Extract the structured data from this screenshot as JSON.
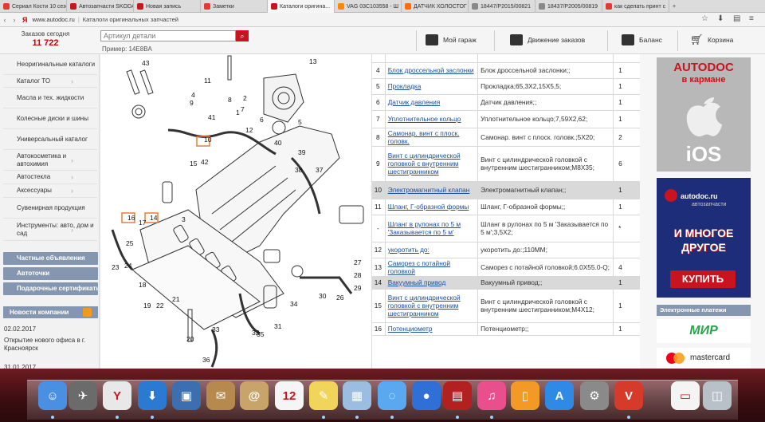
{
  "browser": {
    "tabs": [
      {
        "label": "Сериал Кости 10 сезо",
        "color": "#e53935"
      },
      {
        "label": "Автозапчасти SKODA",
        "color": "#c8141e"
      },
      {
        "label": "Новая запись",
        "color": "#c8141e"
      },
      {
        "label": "Заметки",
        "color": "#e53935"
      },
      {
        "label": "Каталоги оригина...",
        "color": "#c8141e"
      },
      {
        "label": "VAG 03C103558 - Ш",
        "color": "#ff8800"
      },
      {
        "label": "ДАТЧИК ХОЛОСТОГ",
        "color": "#ff6d00"
      },
      {
        "label": "18447/P2015/00821",
        "color": "#888888"
      },
      {
        "label": "18437/P2005/00819",
        "color": "#888888"
      },
      {
        "label": "как сделать принт с",
        "color": "#e53935"
      }
    ],
    "url": "www.autodoc.ru",
    "page_title": "Каталоги оригинальных запчастей"
  },
  "header": {
    "orders_label": "Заказов сегодня",
    "orders_count": "11 722",
    "search_placeholder": "Артикул детали",
    "example": "Пример: 14E8BA",
    "nav": [
      "Мой гараж",
      "Движение заказов",
      "Баланс",
      "Корзина"
    ]
  },
  "sidebar": {
    "items": [
      "Неоригинальные каталоги",
      "Каталог ТО",
      "Масла и тех. жидкости",
      "Колесные диски и шины",
      "Универсальный каталог",
      "Автокосметика и автохимия",
      "Автостекла",
      "Аксессуары",
      "Сувенирная продукция",
      "Инструменты: авто, дом и сад"
    ],
    "buttons": [
      "Частные объявления",
      "Автоточки",
      "Подарочные сертификаты"
    ],
    "news_title": "Новости компании",
    "news": [
      {
        "date": "02.02.2017",
        "text": "Открытие нового офиса в г. Красноярск"
      },
      {
        "date": "31.01.2017",
        "text": ""
      }
    ]
  },
  "diagram": {
    "labels": [
      "43",
      "13",
      "11",
      "2",
      "9",
      "8",
      "7",
      "6",
      "41",
      "1",
      "10",
      "5",
      "40",
      "39",
      "38",
      "42",
      "37",
      "15",
      "3",
      "16",
      "14",
      "17",
      "24",
      "25",
      "23",
      "21",
      "22",
      "19",
      "20",
      "33",
      "35",
      "32",
      "31",
      "34",
      "30",
      "26",
      "27",
      "28",
      "29",
      "36",
      "18",
      "4",
      "12"
    ]
  },
  "parts_table": {
    "rows": [
      {
        "n": "4",
        "name": "Блок дроссельной заслонки",
        "desc": "Блок дроссельной заслонки;;",
        "qty": "1",
        "hl": false
      },
      {
        "n": "5",
        "name": "Прокладка",
        "desc": "Прокладка;65,3X2,15X5,5;",
        "qty": "1",
        "hl": false
      },
      {
        "n": "6",
        "name": "Датчик давления",
        "desc": "Датчик давления;;",
        "qty": "1",
        "hl": false
      },
      {
        "n": "7",
        "name": "Уплотнительное кольцо",
        "desc": "Уплотнительное кольцо;7,59X2,62;",
        "qty": "1",
        "hl": false
      },
      {
        "n": "8",
        "name": "Самонар. винт с плоск. головк.",
        "desc": "Самонар. винт с плоск. головк.;5X20;",
        "qty": "2",
        "hl": false
      },
      {
        "n": "9",
        "name": "Винт с цилиндрической головкой с внутренним шестигранником",
        "desc": "Винт с цилиндрической головкой с внутренним шестигранником;M8X35;",
        "qty": "6",
        "hl": false
      },
      {
        "n": "10",
        "name": "Электромагнитный клапан",
        "desc": "Электромагнитный клапан;;",
        "qty": "1",
        "hl": true
      },
      {
        "n": "11",
        "name": "Шланг, Г-образной формы",
        "desc": "Шланг, Г-образной формы;;",
        "qty": "1",
        "hl": false
      },
      {
        "n": "-",
        "name": "Шланг в рулонах по 5 м 'Заказывается по 5 м'",
        "desc": "Шланг в рулонах по 5 м 'Заказывается по 5 м';3,5X2;",
        "qty": "*",
        "hl": false
      },
      {
        "n": "12",
        "name": "укоротить до:",
        "desc": "укоротить до:;110MM;",
        "qty": "",
        "hl": false
      },
      {
        "n": "13",
        "name": "Саморез с потайной головкой",
        "desc": "Саморез с потайной головкой;6.0X55.0-Q;",
        "qty": "4",
        "hl": false
      },
      {
        "n": "14",
        "name": "Вакуумный привод",
        "desc": "Вакуумный привод;;",
        "qty": "1",
        "hl": true
      },
      {
        "n": "15",
        "name": "Винт с цилиндрической головкой с внутренним шестигранником",
        "desc": "Винт с цилиндрической головкой с внутренним шестигранником;M4X12;",
        "qty": "1",
        "hl": false
      },
      {
        "n": "16",
        "name": "Потенциометр",
        "desc": "Потенциометр;;",
        "qty": "1",
        "hl": false
      }
    ]
  },
  "ads": {
    "ad1_title": "AUTODOC",
    "ad1_sub": "в кармане",
    "ad1_os": "iOS",
    "ad2_logo": "autodoc.ru",
    "ad2_logo_sub": "автозапчасти",
    "ad2_text": "И МНОГОЕ ДРУГОЕ",
    "ad2_button": "КУПИТЬ",
    "payments_title": "Электронные платежи",
    "mir": "МИР",
    "mastercard": "mastercard"
  },
  "dock": {
    "icons": [
      {
        "name": "finder-icon",
        "glyph": "☺",
        "color": "#4a90e2"
      },
      {
        "name": "launchpad-icon",
        "glyph": "✈",
        "color": "#6b6b6b"
      },
      {
        "name": "yandex-browser-icon",
        "glyph": "Y",
        "color": "#e8e8e8"
      },
      {
        "name": "downloader-icon",
        "glyph": "⬇",
        "color": "#2a7ad2"
      },
      {
        "name": "photos-icon",
        "glyph": "▣",
        "color": "#3b6fb0"
      },
      {
        "name": "mail-icon",
        "glyph": "✉",
        "color": "#b68a4e"
      },
      {
        "name": "contacts-icon",
        "glyph": "@",
        "color": "#c8a46a"
      },
      {
        "name": "calendar-icon",
        "glyph": "12",
        "color": "#f5f5f5"
      },
      {
        "name": "notes-icon",
        "glyph": "✎",
        "color": "#f1d55a"
      },
      {
        "name": "preview-icon",
        "glyph": "▦",
        "color": "#9bbde0"
      },
      {
        "name": "messages-icon",
        "glyph": "◌",
        "color": "#5aa9f0"
      },
      {
        "name": "facetime-icon",
        "glyph": "●",
        "color": "#2f6fd6"
      },
      {
        "name": "photo-booth-icon",
        "glyph": "▤",
        "color": "#b32020"
      },
      {
        "name": "itunes-icon",
        "glyph": "♫",
        "color": "#e94f8c"
      },
      {
        "name": "ibooks-icon",
        "glyph": "▯",
        "color": "#f39a26"
      },
      {
        "name": "app-store-icon",
        "glyph": "A",
        "color": "#2f8ae6"
      },
      {
        "name": "system-preferences-icon",
        "glyph": "⚙",
        "color": "#8a8a8a"
      },
      {
        "name": "vkontakte-icon",
        "glyph": "V",
        "color": "#d63a2a"
      },
      {
        "name": "document-icon",
        "glyph": "▭",
        "color": "#f4f4f4"
      },
      {
        "name": "trash-icon",
        "glyph": "◫",
        "color": "#b8c0c8"
      }
    ],
    "calendar_day": "12"
  }
}
